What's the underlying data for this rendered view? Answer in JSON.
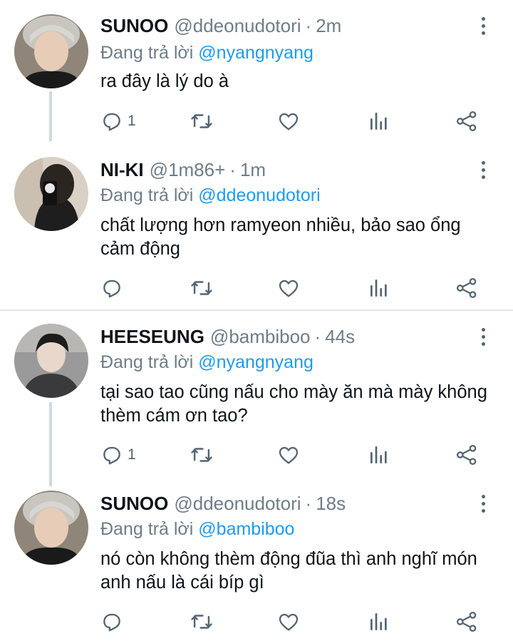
{
  "tweets": [
    {
      "name": "SUNOO",
      "handle": "@ddeonudotori",
      "time": "2m",
      "replying_prefix": "Đang trả lời ",
      "replying_to": "@nyangnyang",
      "text": "ra đây là lý do à",
      "reply_count": "1"
    },
    {
      "name": "NI-KI",
      "handle": "@1m86+",
      "time": "1m",
      "replying_prefix": "Đang trả lời ",
      "replying_to": "@ddeonudotori",
      "text": "chất lượng hơn ramyeon nhiều, bảo sao ổng cảm động",
      "reply_count": ""
    },
    {
      "name": "HEESEUNG",
      "handle": "@bambiboo",
      "time": "44s",
      "replying_prefix": "Đang trả lời ",
      "replying_to": "@nyangnyang",
      "text": "tại sao tao cũng nấu cho mày ăn mà mày không thèm cám ơn tao?",
      "reply_count": "1"
    },
    {
      "name": "SUNOO",
      "handle": "@ddeonudotori",
      "time": "18s",
      "replying_prefix": "Đang trả lời ",
      "replying_to": "@bambiboo",
      "text": "nó còn không thèm động đũa thì anh nghĩ món anh nấu là cái bíp gì",
      "reply_count": ""
    }
  ],
  "dot_separator": "·",
  "icons": [
    "reply-icon",
    "retweet-icon",
    "like-icon",
    "analytics-icon",
    "share-icon",
    "more-options-icon"
  ],
  "colors": {
    "link": "#1d9bf0",
    "secondary": "#6e7d88",
    "thread_line": "#cfd9de",
    "text": "#0f1419"
  }
}
